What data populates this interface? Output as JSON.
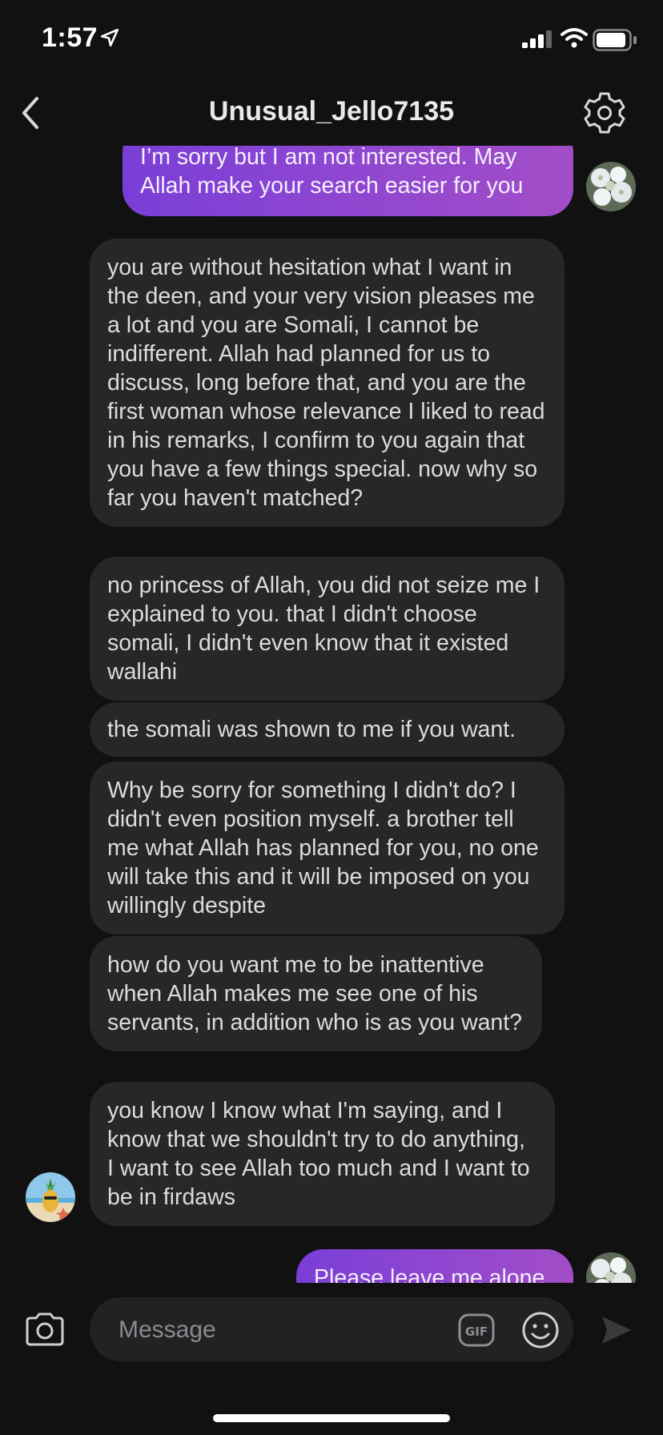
{
  "status_bar": {
    "time": "1:57"
  },
  "header": {
    "title": "Unusual_Jello7135"
  },
  "messages": [
    {
      "direction": "outgoing",
      "text": "I’m sorry but I am not interested. May Allah make your search easier for you"
    },
    {
      "direction": "incoming",
      "text": "you are without hesitation what I want in the deen, and your very vision pleases me a lot and you are Somali, I cannot be indifferent. Allah had planned for us to discuss, long before that, and you are the first woman whose relevance I liked to read in his remarks, I confirm to you again that you have a few things special. now why so far you haven't matched?"
    },
    {
      "direction": "incoming",
      "text": "no princess of Allah, you did not seize me I explained to you. that I didn't choose somali, I didn't even know that it existed wallahi"
    },
    {
      "direction": "incoming",
      "text": "the somali was shown to me if you want."
    },
    {
      "direction": "incoming",
      "text": "Why be sorry for something I didn't do? I didn't even position myself. a brother tell me what Allah has planned for you, no one will take this and it will be imposed on you willingly despite"
    },
    {
      "direction": "incoming",
      "text": "how do you want me to be inattentive when Allah makes me see one of his servants, in addition who is as you want?"
    },
    {
      "direction": "incoming",
      "text": "you know I know what I'm saying, and I know that we shouldn't try to do anything, I want to see Allah too much and I want to be in firdaws"
    },
    {
      "direction": "outgoing",
      "text": "Please leave me alone"
    }
  ],
  "composer": {
    "placeholder": "Message",
    "gif_label": "GIF"
  },
  "colors": {
    "background": "#111111",
    "incoming_bubble": "#272729",
    "outgoing_gradient_start": "#7a3ed6",
    "outgoing_gradient_end": "#a24dc7"
  },
  "icons": {
    "status": [
      "location-arrow-icon",
      "signal-icon",
      "wifi-icon",
      "battery-icon"
    ],
    "header": [
      "chevron-left-icon",
      "gear-icon"
    ],
    "composer": [
      "camera-icon",
      "gif-icon",
      "emoji-icon",
      "send-icon"
    ]
  }
}
